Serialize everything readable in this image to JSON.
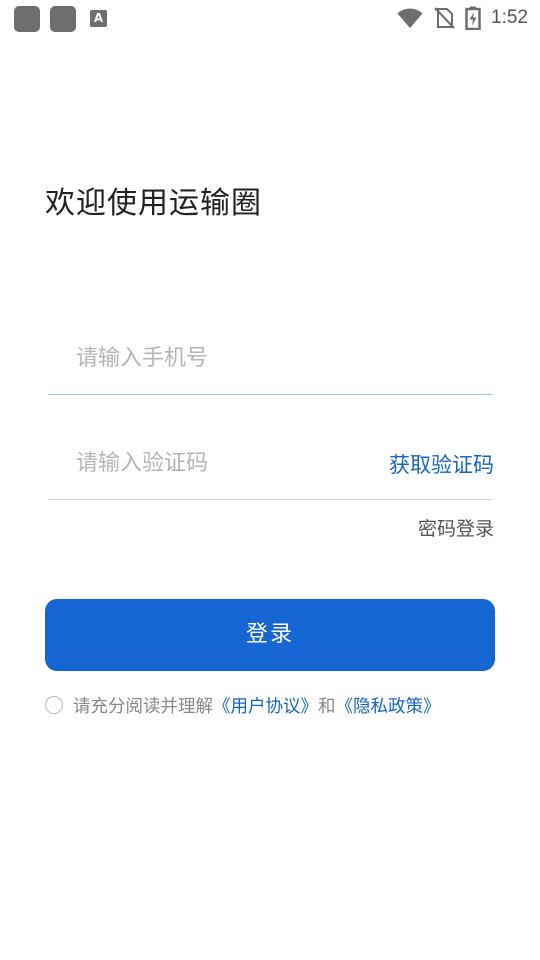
{
  "status_bar": {
    "time": "1:52",
    "icons": [
      "app-icon",
      "app-icon",
      "a-notification-icon",
      "wifi-icon",
      "no-sim-icon",
      "battery-charging-icon"
    ],
    "notification_glyph": "A"
  },
  "login": {
    "welcome_title": "欢迎使用运输圈",
    "phone_placeholder": "请输入手机号",
    "phone_value": "",
    "code_placeholder": "请输入验证码",
    "code_value": "",
    "get_code_label": "获取验证码",
    "password_login_label": "密码登录",
    "login_button_label": "登录"
  },
  "agreement": {
    "prefix": "请充分阅读并理解",
    "user_agreement": "《用户协议》",
    "conjunction": "和",
    "privacy_policy": "《隐私政策》",
    "checked": false
  },
  "colors": {
    "primary": "#1565d2",
    "link": "#1565c8",
    "placeholder": "#b5b5b5"
  }
}
